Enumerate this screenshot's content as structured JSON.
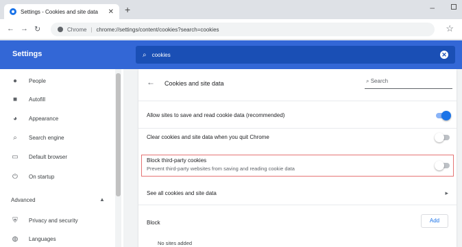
{
  "browser": {
    "tab_title": "Settings - Cookies and site data",
    "tab_close": "✕",
    "new_tab": "+",
    "omnibox": {
      "origin": "Chrome",
      "separator": "|",
      "url": "chrome://settings/content/cookies?search=cookies"
    }
  },
  "header": {
    "title": "Settings",
    "search_value": "cookies",
    "clear_label": "✕"
  },
  "sidebar": {
    "items": [
      {
        "label": "People",
        "icon": "person-icon"
      },
      {
        "label": "Autofill",
        "icon": "clipboard-icon"
      },
      {
        "label": "Appearance",
        "icon": "palette-icon"
      },
      {
        "label": "Search engine",
        "icon": "search-icon"
      },
      {
        "label": "Default browser",
        "icon": "browser-icon"
      },
      {
        "label": "On startup",
        "icon": "power-icon"
      }
    ],
    "advanced_label": "Advanced",
    "advanced_items": [
      {
        "label": "Privacy and security",
        "icon": "shield-icon"
      },
      {
        "label": "Languages",
        "icon": "globe-icon"
      }
    ]
  },
  "main": {
    "page_title": "Cookies and site data",
    "search_placeholder": "Search",
    "rows": [
      {
        "label": "Allow sites to save and read cookie data (recommended)",
        "toggle": true
      },
      {
        "label": "Clear cookies and site data when you quit Chrome",
        "toggle": false
      },
      {
        "label": "Block third-party cookies",
        "sub": "Prevent third-party websites from saving and reading cookie data",
        "toggle": false
      },
      {
        "label": "See all cookies and site data"
      }
    ],
    "block_label": "Block",
    "add_label": "Add",
    "no_sites": "No sites added"
  },
  "colors": {
    "header_blue": "#3367d6",
    "toggle_on": "#1a73e8",
    "highlight_border": "#e57373"
  }
}
